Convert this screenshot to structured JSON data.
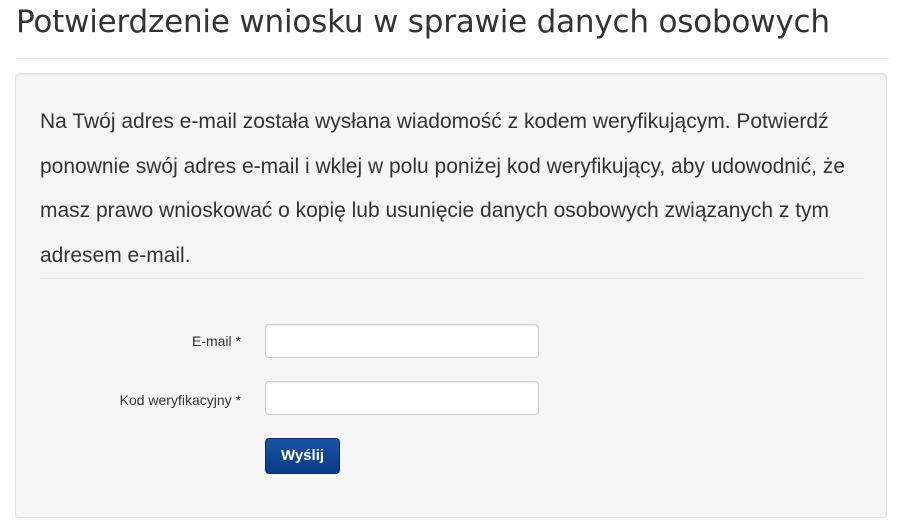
{
  "page": {
    "title": "Potwierdzenie wniosku w sprawie danych osobowych"
  },
  "intro": {
    "text": "Na Twój adres e-mail została wysłana wiadomość z kodem weryfikującym. Potwierdź ponownie swój adres e-mail i wklej w polu poniżej kod weryfikujący, aby udowodnić, że masz prawo wnioskować o kopię lub usunięcie danych osobowych związanych z tym adresem e-mail."
  },
  "form": {
    "email_label": "E-mail *",
    "email_value": "",
    "code_label": "Kod weryfikacyjny *",
    "code_value": "",
    "submit_label": "Wyślij"
  },
  "colors": {
    "button": "#0a3b86",
    "well_background": "#f5f5f5"
  }
}
